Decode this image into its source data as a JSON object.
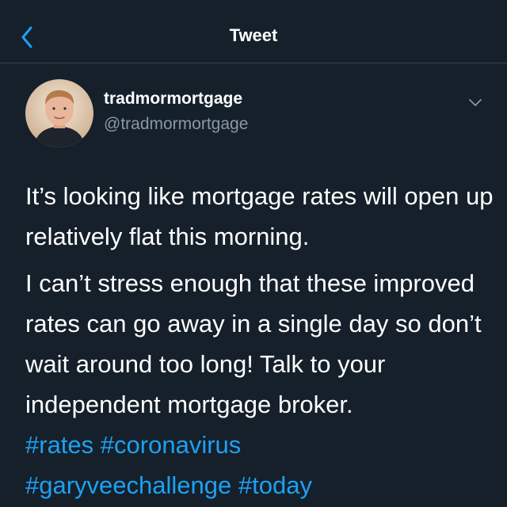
{
  "header": {
    "title": "Tweet",
    "back_icon": "chevron-left-icon"
  },
  "author": {
    "display_name": "tradmormortgage",
    "handle": "@tradmormortgage",
    "menu_icon": "chevron-down-icon"
  },
  "tweet": {
    "paragraphs": [
      "It’s looking like mortgage rates will open up relatively flat this morning.",
      "I can’t stress enough that these improved rates can go away in a single day so don’t wait around too long! Talk to your independent mortgage broker."
    ],
    "hashtags": [
      "#rates",
      "#coronavirus",
      "#garyveechallenge",
      "#today"
    ]
  },
  "colors": {
    "background": "#15202b",
    "accent": "#1da1f2",
    "secondary_text": "#8899a6",
    "divider": "#38444d"
  }
}
